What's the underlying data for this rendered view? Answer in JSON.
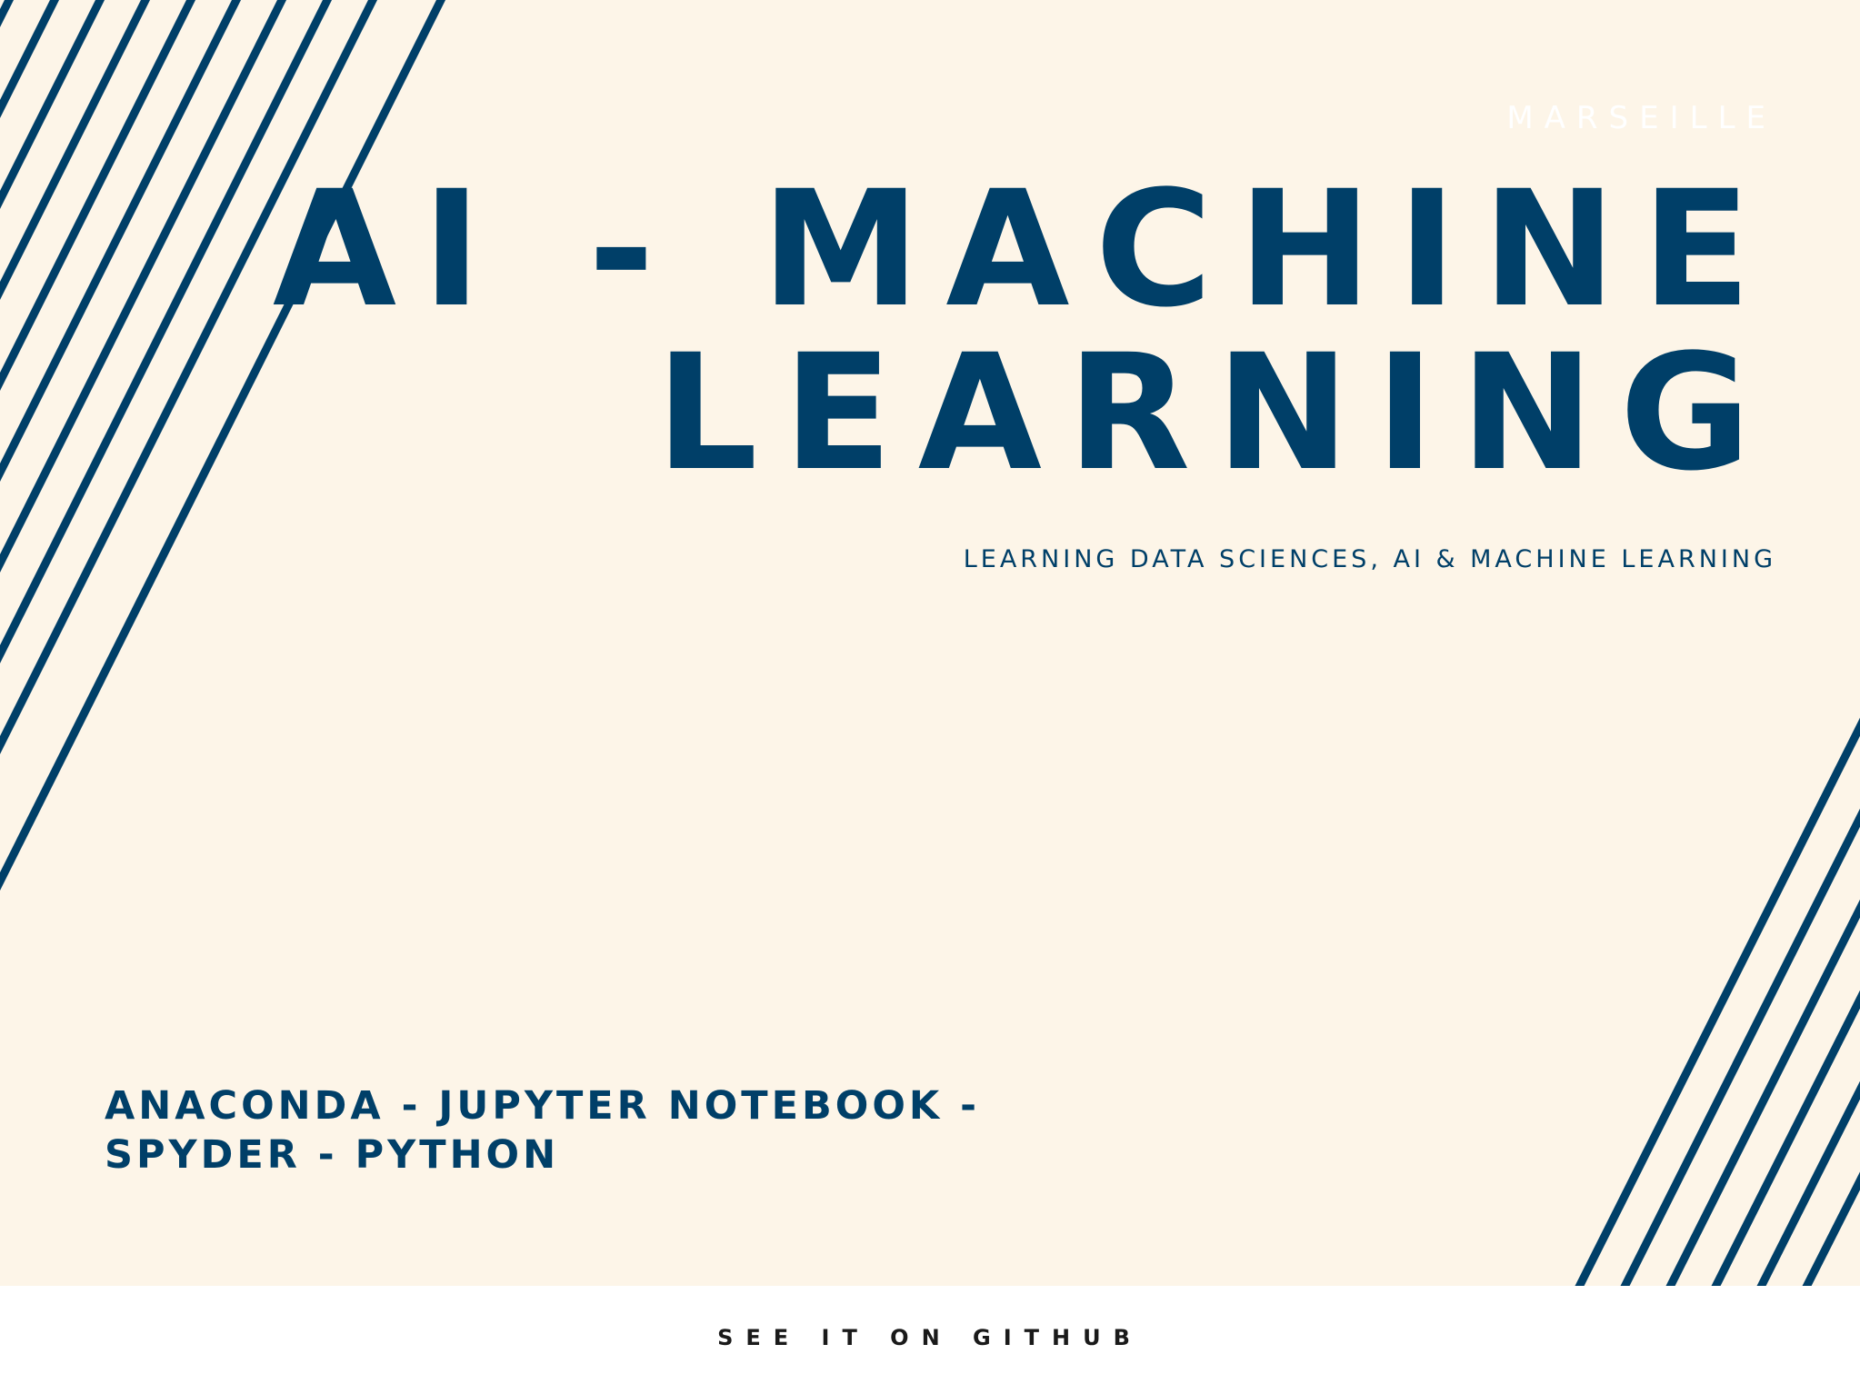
{
  "banner": {
    "location": "MARSEILLE",
    "title_line1": "AI - MACHINE",
    "title_line2": "LEARNING",
    "tagline": "LEARNING DATA SCIENCES, AI & MACHINE LEARNING",
    "tools_line1": "ANACONDA - JUPYTER NOTEBOOK -",
    "tools_line2": "SPYDER - PYTHON"
  },
  "footer": {
    "link_label": "SEE IT ON GITHUB"
  },
  "colors": {
    "background": "#fdf5e8",
    "accent": "#003f68",
    "footer_background": "#ffffff",
    "footer_text": "#1a1a1a"
  }
}
